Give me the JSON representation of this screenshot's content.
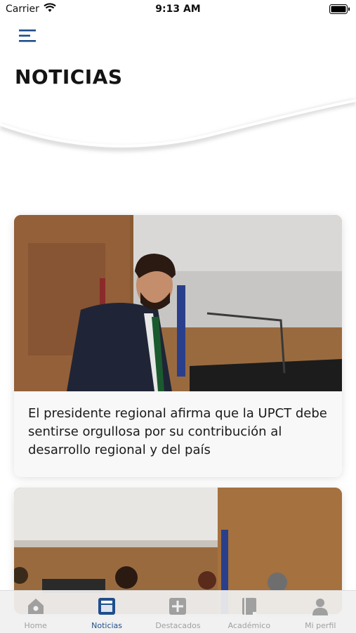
{
  "status_bar": {
    "carrier": "Carrier",
    "time": "9:13 AM"
  },
  "header": {
    "menu_icon": "hamburger-menu-icon",
    "title": "NOTICIAS"
  },
  "news": [
    {
      "headline": "El presidente regional afirma que la UPCT debe sentirse orgullosa por su contribución al desarrollo regional y del país"
    },
    {
      "headline": ""
    }
  ],
  "tabbar": {
    "tabs": [
      {
        "label": "Home",
        "icon": "home-icon",
        "active": false
      },
      {
        "label": "Noticias",
        "icon": "newspaper-icon",
        "active": true
      },
      {
        "label": "Destacados",
        "icon": "plus-square-icon",
        "active": false
      },
      {
        "label": "Académico",
        "icon": "book-icon",
        "active": false
      },
      {
        "label": "Mi perfil",
        "icon": "user-icon",
        "active": false
      }
    ]
  },
  "colors": {
    "accent": "#1f4e8c",
    "inactive": "#a0a0a0",
    "title": "#141414"
  }
}
